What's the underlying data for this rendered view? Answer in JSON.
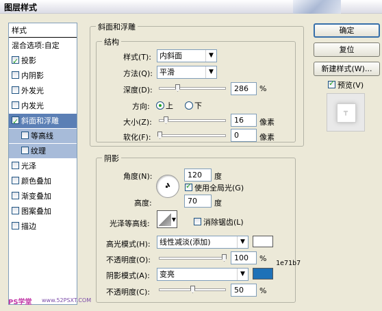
{
  "window": {
    "title": "图层样式"
  },
  "style_list": {
    "header": "样式",
    "blend_options": "混合选项:自定",
    "items": [
      {
        "label": "投影",
        "checked": true
      },
      {
        "label": "内阴影",
        "checked": false
      },
      {
        "label": "外发光",
        "checked": false
      },
      {
        "label": "内发光",
        "checked": false
      },
      {
        "label": "斜面和浮雕",
        "checked": true,
        "active": true
      },
      {
        "label": "等高线",
        "checked": false,
        "sub": true
      },
      {
        "label": "纹理",
        "checked": false,
        "sub": true
      },
      {
        "label": "光泽",
        "checked": false
      },
      {
        "label": "颜色叠加",
        "checked": false
      },
      {
        "label": "渐变叠加",
        "checked": false
      },
      {
        "label": "图案叠加",
        "checked": false
      },
      {
        "label": "描边",
        "checked": false
      }
    ]
  },
  "bevel": {
    "section_title": "斜面和浮雕",
    "structure_title": "结构",
    "style_label": "样式(T):",
    "style_value": "内斜面",
    "technique_label": "方法(Q):",
    "technique_value": "平滑",
    "depth_label": "深度(D):",
    "depth_value": "286",
    "depth_unit": "%",
    "direction_label": "方向:",
    "direction_up": "上",
    "direction_down": "下",
    "size_label": "大小(Z):",
    "size_value": "16",
    "size_unit": "像素",
    "soften_label": "软化(F):",
    "soften_value": "0",
    "soften_unit": "像素"
  },
  "shading": {
    "title": "阴影",
    "angle_label": "角度(N):",
    "angle_value": "120",
    "angle_unit": "度",
    "global_light_label": "使用全局光(G)",
    "global_light_checked": true,
    "altitude_label": "高度:",
    "altitude_value": "70",
    "altitude_unit": "度",
    "gloss_contour_label": "光泽等高线:",
    "antialias_label": "消除锯齿(L)",
    "antialias_checked": false,
    "highlight_mode_label": "高光模式(H):",
    "highlight_mode_value": "线性减淡(添加)",
    "highlight_color": "#ffffff",
    "highlight_opacity_label": "不透明度(O):",
    "highlight_opacity_value": "100",
    "shadow_mode_label": "阴影模式(A):",
    "shadow_mode_value": "变亮",
    "shadow_color": "#1e71b7",
    "shadow_color_label": "1e71b7",
    "shadow_opacity_label": "不透明度(C):",
    "shadow_opacity_value": "50",
    "percent": "%"
  },
  "buttons": {
    "ok": "确定",
    "reset": "复位",
    "new_style": "新建样式(W)...",
    "preview_label": "预览(V)",
    "preview_checked": true
  },
  "watermark": {
    "left": "PS学堂",
    "right": "www.52PSXT.COM"
  }
}
